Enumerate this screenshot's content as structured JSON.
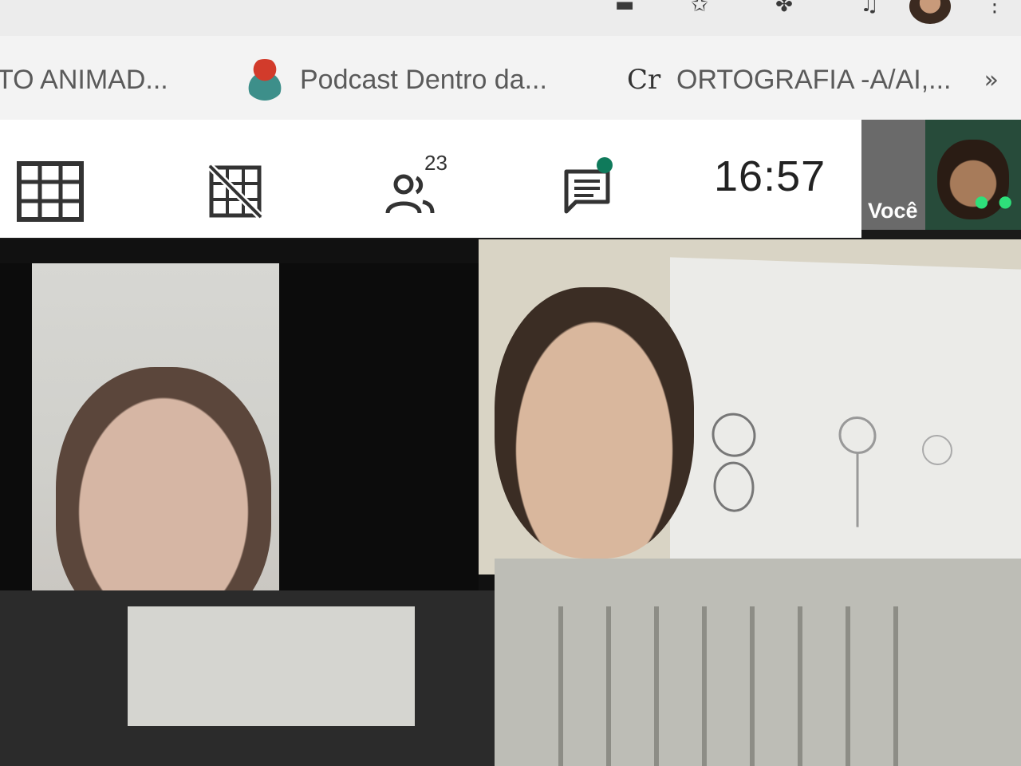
{
  "bookmarks": {
    "items": [
      {
        "label": "TO ANIMAD..."
      },
      {
        "label": "Podcast Dentro da...",
        "icon": "podcast-book-icon"
      },
      {
        "label": "ORTOGRAFIA -A/AI,...",
        "icon": "cr-icon"
      }
    ],
    "more": "»"
  },
  "toolbar": {
    "participants_count": "23",
    "time": "16:57",
    "chat_has_unread": true,
    "accent": "#0f7a5b"
  },
  "self_preview": {
    "label": "Você"
  }
}
